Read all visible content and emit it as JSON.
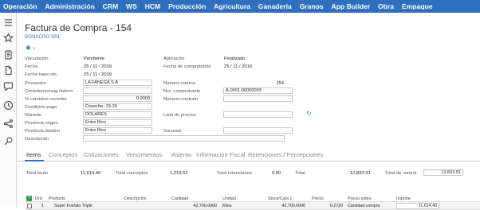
{
  "topnav": {
    "items": [
      "Operación",
      "Administración",
      "CRM",
      "WS",
      "HCM",
      "Producción",
      "Agricultura",
      "Ganadería",
      "Granos",
      "App Builder",
      "Obra",
      "Empaque"
    ]
  },
  "sidebar": {
    "icons": [
      "menu-icon",
      "star-icon",
      "clipboard-icon",
      "document-icon",
      "chat-icon",
      "clock-icon",
      "share-icon",
      "search-user-icon"
    ]
  },
  "header": {
    "title": "Factura de Compra - 154",
    "company": "BONACRO SRL"
  },
  "form": {
    "vinculacion_label": "Vinculación",
    "vinculacion_value": "Pendiente",
    "aplicacion_label": "Aplicación",
    "aplicacion_value": "Finalizado",
    "fecha_label": "Fecha",
    "fecha_value": "25 / 11 / 2019",
    "fecha_comp_label": "Fecha de comprobante",
    "fecha_comp_value": "25 / 11 / 2019",
    "fecha_base_label": "Fecha base vto.",
    "fecha_base_value": "25 / 11 / 2019",
    "proveedor_label": "Proveedor",
    "proveedor_value": "LA FANEGA S.A",
    "numero_interno_label": "Número interno",
    "numero_interno_value": "154",
    "corredor_label": "Corredor/consig./interm.",
    "corredor_value": "",
    "nro_comprobante_label": "Nro. comprobante",
    "nro_comprobante_value": "A-0001-00000003",
    "comision_label": "% comision corredor",
    "comision_value": "0.0000",
    "numero_contrato_label": "Número contrato",
    "numero_contrato_value": "",
    "condicion_label": "Condición pago",
    "condicion_value": "Cosecha -19-20",
    "moneda_label": "Moneda",
    "moneda_value": "DOLARES",
    "lista_precios_label": "Lista de precios",
    "lista_precios_value": "",
    "prov_origen_label": "Provincia origen",
    "prov_origen_value": "Entre Rios",
    "prov_destino_label": "Provincia destino",
    "prov_destino_value": "Entre Rios",
    "sucursal_label": "Sucursal",
    "sucursal_value": "",
    "descripcion_label": "Descripción",
    "descripcion_value": ""
  },
  "tabs": [
    "Items",
    "Conceptos",
    "Cotizaciones",
    "Vencimientos",
    "Asiento",
    "Información Fiscal",
    "Retenciones / Percepciones"
  ],
  "totals": {
    "bruto_label": "Total bruto",
    "bruto_value": "11,614.40",
    "conceptos_label": "Total conceptos",
    "conceptos_value": "1,219.51",
    "retenciones_label": "Total retenciones",
    "retenciones_value": "0.00",
    "total_label": "Total",
    "total_value": "12,833.91",
    "control_label": "Total de control",
    "control_value": "12,833.91"
  },
  "grid": {
    "headers": [
      "Ord",
      "Producto",
      "Descripción",
      "Cantidad",
      "Unidad",
      "Stock/Cant.1",
      "Precio",
      "Precio sobre",
      "Importe"
    ],
    "rows": [
      [
        "1",
        "Super Fosfato Triple",
        "",
        "42,700.0000",
        "Kilos",
        "42,700.0000",
        "0.2720",
        "Cantidad compra",
        "11,614.40"
      ]
    ]
  },
  "colors": {
    "nav": "#2f6fbf",
    "accent": "#3c78c8",
    "add_button": "#2c9c4c"
  }
}
